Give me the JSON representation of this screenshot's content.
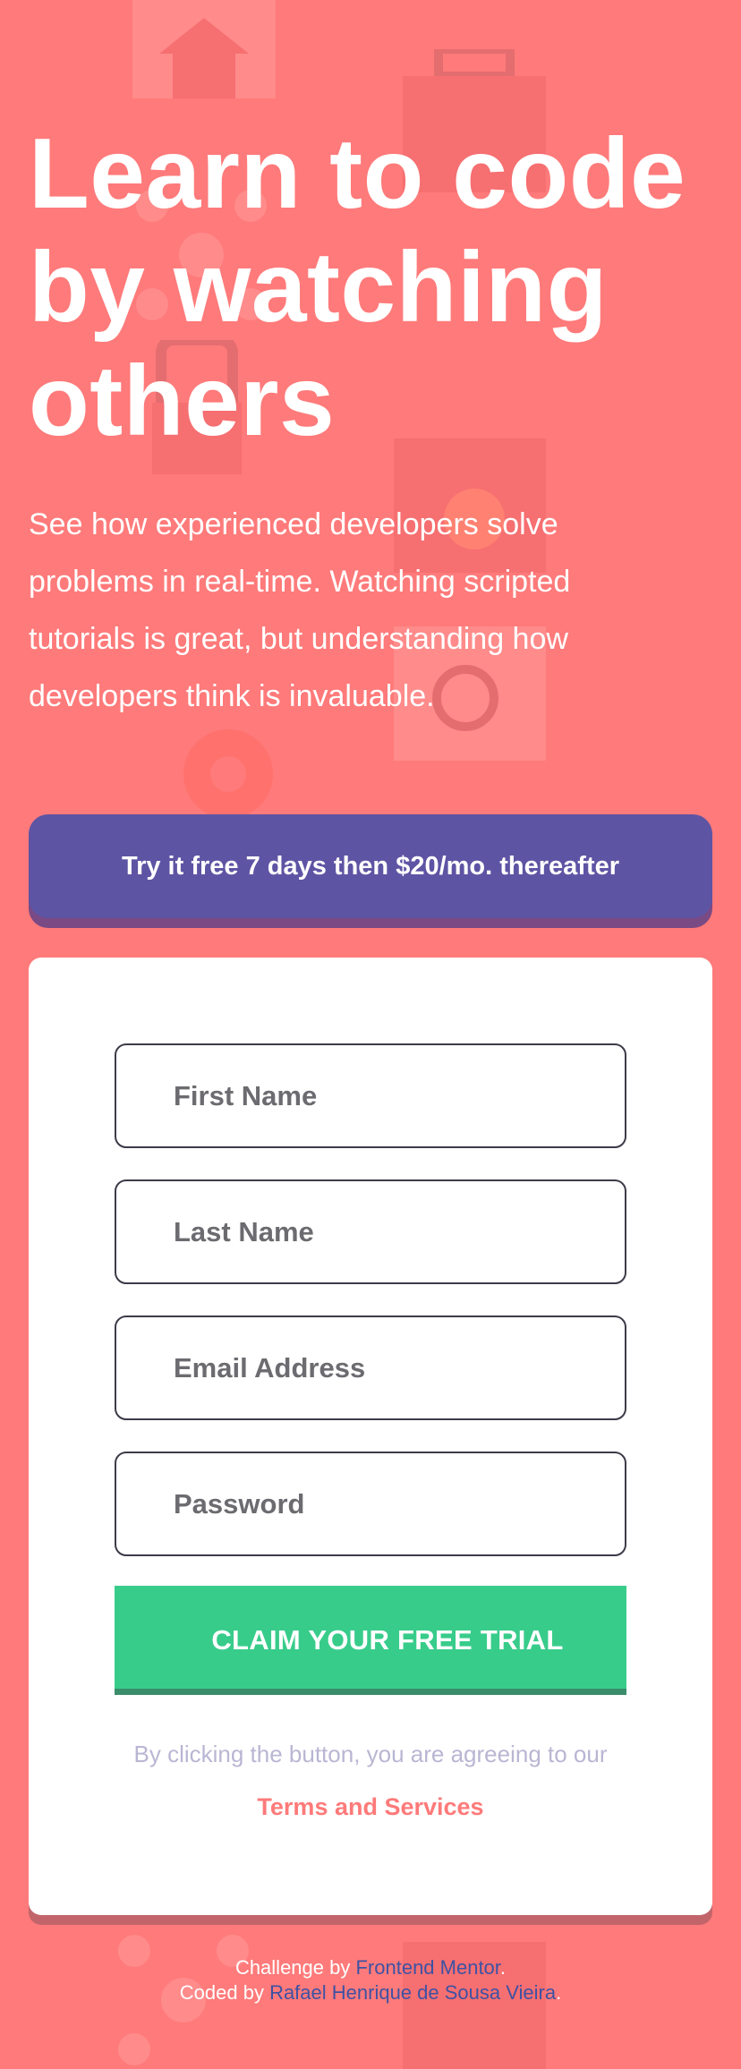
{
  "hero": {
    "title": "Learn to code by watching others",
    "description": "See how experienced developers solve problems in real-time. Watching scripted tutorials is great, but understanding how developers think is invaluable."
  },
  "promo": {
    "bold": "Try it free 7 days",
    "rest": " then $20/mo. thereafter"
  },
  "form": {
    "fields": [
      {
        "placeholder": "First Name"
      },
      {
        "placeholder": "Last Name"
      },
      {
        "placeholder": "Email Address"
      },
      {
        "placeholder": "Password"
      }
    ],
    "submit_label": "CLAIM YOUR FREE TRIAL",
    "terms_text": "By clicking the button, you are agreeing to our",
    "terms_link": "Terms and Services"
  },
  "footer": {
    "challenge_prefix": "Challenge by ",
    "challenge_link": "Frontend Mentor",
    "challenge_suffix": ".",
    "coded_prefix": "Coded by ",
    "coded_link": "Rafael Henrique de Sousa Vieira",
    "coded_suffix": "."
  },
  "colors": {
    "background": "#ff7a7a",
    "promo": "#5e54a4",
    "button": "#38cc8b",
    "link": "#3e52a3"
  },
  "icons": [
    "house-icon",
    "briefcase-icon",
    "network-icon",
    "folder-icon",
    "gear-icon",
    "magnifier-icon",
    "lock-icon"
  ]
}
